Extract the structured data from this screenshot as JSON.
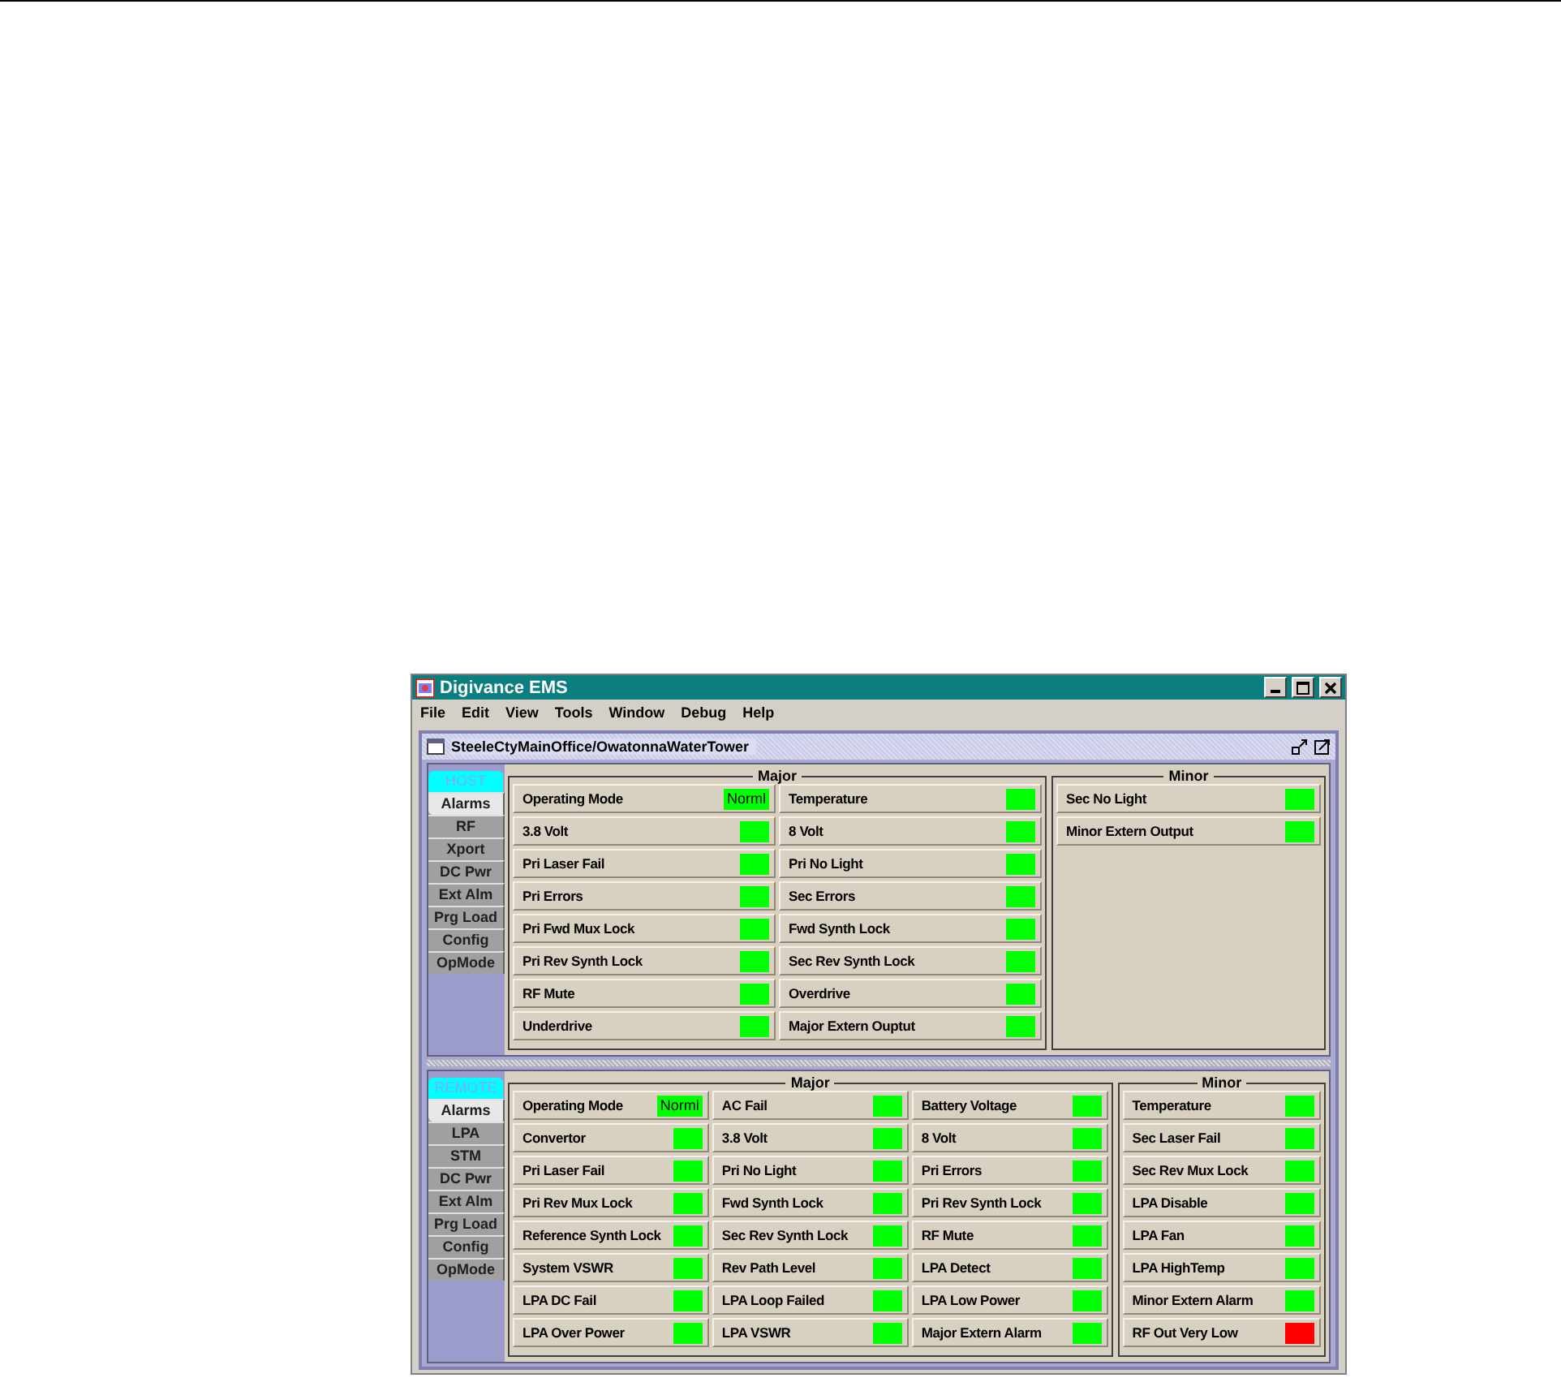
{
  "window": {
    "title": "Digivance EMS"
  },
  "menu": [
    "File",
    "Edit",
    "View",
    "Tools",
    "Window",
    "Debug",
    "Help"
  ],
  "frame": {
    "title": "SteeleCtyMainOffice/OwatonnaWaterTower"
  },
  "panes": [
    {
      "header": "HOST",
      "tabs": [
        {
          "label": "Alarms",
          "selected": true
        },
        {
          "label": "RF",
          "selected": false
        },
        {
          "label": "Xport",
          "selected": false
        },
        {
          "label": "DC Pwr",
          "selected": false
        },
        {
          "label": "Ext Alm",
          "selected": false
        },
        {
          "label": "Prg Load",
          "selected": false
        },
        {
          "label": "Config",
          "selected": false
        },
        {
          "label": "OpMode",
          "selected": false
        }
      ],
      "major": {
        "title": "Major",
        "columns": [
          [
            {
              "label": "Operating Mode",
              "value": "Norml",
              "color": "#00ff00"
            },
            {
              "label": "3.8 Volt",
              "color": "#00ff00"
            },
            {
              "label": "Pri Laser Fail",
              "color": "#00ff00"
            },
            {
              "label": "Pri Errors",
              "color": "#00ff00"
            },
            {
              "label": "Pri Fwd Mux Lock",
              "color": "#00ff00"
            },
            {
              "label": "Pri Rev Synth Lock",
              "color": "#00ff00"
            },
            {
              "label": "RF Mute",
              "color": "#00ff00"
            },
            {
              "label": "Underdrive",
              "color": "#00ff00"
            }
          ],
          [
            {
              "label": "Temperature",
              "color": "#00ff00"
            },
            {
              "label": "8 Volt",
              "color": "#00ff00"
            },
            {
              "label": "Pri No Light",
              "color": "#00ff00"
            },
            {
              "label": "Sec Errors",
              "color": "#00ff00"
            },
            {
              "label": "Fwd Synth Lock",
              "color": "#00ff00"
            },
            {
              "label": "Sec Rev Synth Lock",
              "color": "#00ff00"
            },
            {
              "label": "Overdrive",
              "color": "#00ff00"
            },
            {
              "label": "Major Extern Ouptut",
              "color": "#00ff00"
            }
          ]
        ]
      },
      "minor": {
        "title": "Minor",
        "items": [
          {
            "label": "Sec No Light",
            "color": "#00ff00"
          },
          {
            "label": "Minor Extern Output",
            "color": "#00ff00"
          }
        ]
      }
    },
    {
      "header": "REMOTE",
      "tabs": [
        {
          "label": "Alarms",
          "selected": true
        },
        {
          "label": "LPA",
          "selected": false
        },
        {
          "label": "STM",
          "selected": false
        },
        {
          "label": "DC Pwr",
          "selected": false
        },
        {
          "label": "Ext Alm",
          "selected": false
        },
        {
          "label": "Prg Load",
          "selected": false
        },
        {
          "label": "Config",
          "selected": false
        },
        {
          "label": "OpMode",
          "selected": false
        }
      ],
      "major": {
        "title": "Major",
        "columns": [
          [
            {
              "label": "Operating Mode",
              "value": "Norml",
              "color": "#00ff00"
            },
            {
              "label": "Convertor",
              "color": "#00ff00"
            },
            {
              "label": "Pri Laser Fail",
              "color": "#00ff00"
            },
            {
              "label": "Pri Rev Mux Lock",
              "color": "#00ff00"
            },
            {
              "label": "Reference Synth Lock",
              "color": "#00ff00"
            },
            {
              "label": "System VSWR",
              "color": "#00ff00"
            },
            {
              "label": "LPA DC Fail",
              "color": "#00ff00"
            },
            {
              "label": "LPA Over Power",
              "color": "#00ff00"
            }
          ],
          [
            {
              "label": "AC Fail",
              "color": "#00ff00"
            },
            {
              "label": "3.8 Volt",
              "color": "#00ff00"
            },
            {
              "label": "Pri No Light",
              "color": "#00ff00"
            },
            {
              "label": "Fwd Synth Lock",
              "color": "#00ff00"
            },
            {
              "label": "Sec Rev Synth Lock",
              "color": "#00ff00"
            },
            {
              "label": "Rev Path Level",
              "color": "#00ff00"
            },
            {
              "label": "LPA Loop Failed",
              "color": "#00ff00"
            },
            {
              "label": "LPA VSWR",
              "color": "#00ff00"
            }
          ],
          [
            {
              "label": "Battery Voltage",
              "color": "#00ff00"
            },
            {
              "label": "8 Volt",
              "color": "#00ff00"
            },
            {
              "label": "Pri Errors",
              "color": "#00ff00"
            },
            {
              "label": "Pri Rev Synth Lock",
              "color": "#00ff00"
            },
            {
              "label": "RF Mute",
              "color": "#00ff00"
            },
            {
              "label": "LPA Detect",
              "color": "#00ff00"
            },
            {
              "label": "LPA Low Power",
              "color": "#00ff00"
            },
            {
              "label": "Major Extern Alarm",
              "color": "#00ff00"
            }
          ]
        ]
      },
      "minor": {
        "title": "Minor",
        "items": [
          {
            "label": "Temperature",
            "color": "#00ff00"
          },
          {
            "label": "Sec Laser Fail",
            "color": "#00ff00"
          },
          {
            "label": "Sec Rev Mux Lock",
            "color": "#00ff00"
          },
          {
            "label": "LPA Disable",
            "color": "#00ff00"
          },
          {
            "label": "LPA Fan",
            "color": "#00ff00"
          },
          {
            "label": "LPA HighTemp",
            "color": "#00ff00"
          },
          {
            "label": "Minor Extern Alarm",
            "color": "#00ff00"
          },
          {
            "label": "RF Out Very Low",
            "color": "#ff0000"
          }
        ]
      }
    }
  ]
}
